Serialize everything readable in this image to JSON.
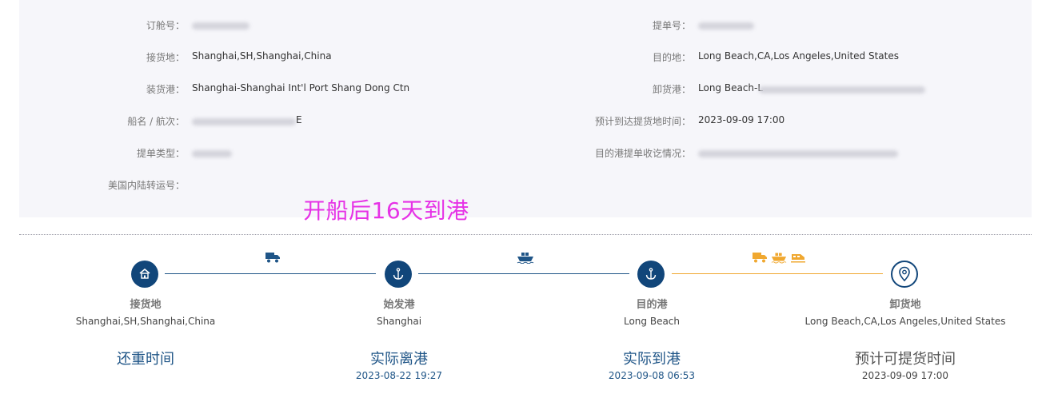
{
  "info": {
    "left": [
      {
        "label": "订舱号：",
        "value": "",
        "redacted": true
      },
      {
        "label": "接货地：",
        "value": "Shanghai,SH,Shanghai,China"
      },
      {
        "label": "装货港：",
        "value": "Shanghai-Shanghai Int'l Port Shang Dong Ctn"
      },
      {
        "label": "船名 / 航次：",
        "value": "E",
        "redacted": true
      },
      {
        "label": "提单类型：",
        "value": "",
        "redacted": true
      },
      {
        "label": "美国内陆转运号：",
        "value": ""
      }
    ],
    "right": [
      {
        "label": "提单号：",
        "value": "",
        "redacted": true
      },
      {
        "label": "目的地：",
        "value": "Long Beach,CA,Los Angeles,United States"
      },
      {
        "label": "卸货港：",
        "value": "Long Beach-L",
        "redacted": true
      },
      {
        "label": "预计到达提货地时间：",
        "value": "2023-09-09 17:00"
      },
      {
        "label": "目的港提单收讫情况：",
        "value": "",
        "redacted": true
      }
    ]
  },
  "annotation": "开船后16天到港",
  "timeline": {
    "stops": [
      {
        "title": "接货地",
        "place": "Shanghai,SH,Shanghai,China",
        "event": "还重时间",
        "time": "",
        "icon": "home-icon"
      },
      {
        "title": "始发港",
        "place": "Shanghai",
        "event": "实际离港",
        "time": "2023-08-22 19:27",
        "icon": "anchor-icon"
      },
      {
        "title": "目的港",
        "place": "Long Beach",
        "event": "实际到港",
        "time": "2023-09-08 06:53",
        "icon": "anchor-icon"
      },
      {
        "title": "卸货地",
        "place": "Long Beach,CA,Los Angeles,United States",
        "event": "预计可提货时间",
        "time": "2023-09-09 17:00",
        "icon": "location-pin-icon"
      }
    ],
    "modes": [
      "truck-icon",
      "ship-icon",
      "truck-ship-rail-icons"
    ]
  },
  "colors": {
    "primary": "#11467a",
    "segment_done": "#1f5587",
    "segment_pending": "#f0a830",
    "annotation": "#e632e6",
    "panel_bg": "#f6f6fa"
  }
}
